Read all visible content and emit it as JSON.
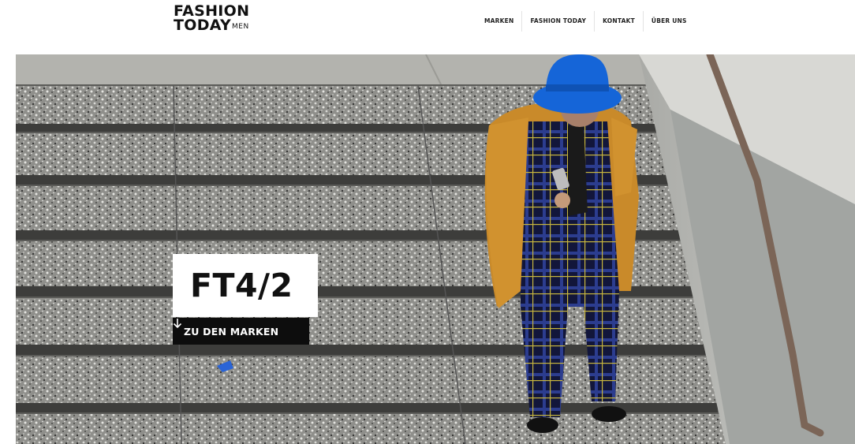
{
  "brand": {
    "line1": "FASHION",
    "line2": "TODAY",
    "suffix": "MEN"
  },
  "nav": {
    "items": [
      {
        "label": "MARKEN"
      },
      {
        "label": "FASHION TODAY"
      },
      {
        "label": "KONTAKT"
      },
      {
        "label": "ÜBER UNS"
      }
    ]
  },
  "hero": {
    "title": "FT4/2",
    "cta_label": "ZU DEN MARKEN",
    "cta_icon": "arrow-down-icon",
    "image_subject": "man-on-stairs-photo"
  },
  "colors": {
    "text": "#111111",
    "cta_background": "#0d0d0d",
    "cta_text": "#ffffff",
    "hat": "#1565d8",
    "jacket": "#c98a2a"
  }
}
